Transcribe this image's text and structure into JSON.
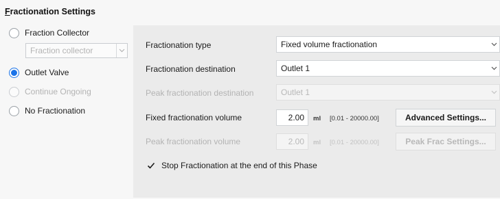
{
  "section": {
    "title_first": "F",
    "title_rest": "ractionation Settings"
  },
  "left": {
    "options": [
      {
        "label": "Fraction Collector",
        "checked": false,
        "disabled": false
      },
      {
        "label": "Outlet Valve",
        "checked": true,
        "disabled": false
      },
      {
        "label": "Continue Ongoing",
        "checked": false,
        "disabled": true
      },
      {
        "label": "No Fractionation",
        "checked": false,
        "disabled": false
      }
    ],
    "fraction_collector_select": "Fraction collector"
  },
  "panel": {
    "type_label": "Fractionation type",
    "type_value": "Fixed volume fractionation",
    "destination_label": "Fractionation destination",
    "destination_value": "Outlet 1",
    "peak_destination_label": "Peak fractionation destination",
    "peak_destination_value": "Outlet 1",
    "fixed_volume_label": "Fixed fractionation volume",
    "fixed_volume_value": "2.00",
    "fixed_volume_unit": "ml",
    "fixed_volume_range": "[0.01 - 20000.00]",
    "advanced_button": "Advanced Settings...",
    "peak_volume_label": "Peak fractionation volume",
    "peak_volume_value": "2.00",
    "peak_volume_unit": "ml",
    "peak_volume_range": "[0.01 - 20000.00]",
    "peak_frac_button": "Peak Frac Settings...",
    "stop_checkbox_label": "Stop Fractionation at the end of this Phase",
    "stop_checked": true
  },
  "colors": {
    "accent": "#1a73e8",
    "panel_bg": "#ebebeb",
    "disabled_text": "#b3b3b3"
  }
}
